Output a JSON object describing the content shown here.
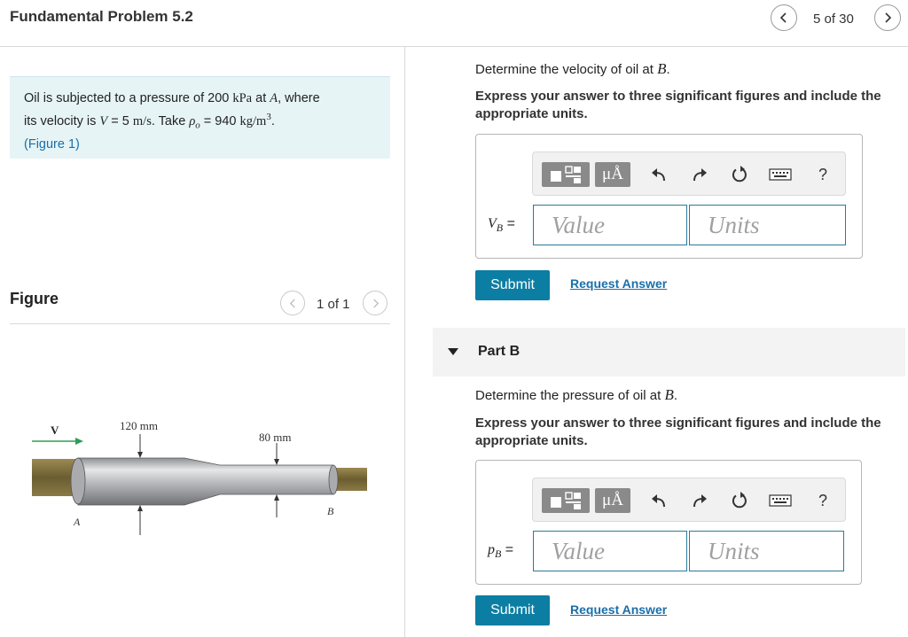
{
  "header": {
    "title": "Fundamental Problem 5.2",
    "nav_count": "5 of 30"
  },
  "problem": {
    "t1": "Oil is subjected to a pressure of 200 ",
    "u1": "kPa",
    "t2": " at ",
    "v1": "A",
    "t3": ", where",
    "t4": "its velocity is ",
    "v2": "V",
    "t5": " = 5 ",
    "u2": "m/s",
    "t6": ". Take ",
    "v3": "ρ",
    "sub3": "o",
    "t7": " = 940 ",
    "u3": "kg/m",
    "sup3": "3",
    "t8": ".",
    "link_open": "(",
    "link": "Figure 1",
    "link_close": ")"
  },
  "figure": {
    "label": "Figure",
    "count": "1 of 1",
    "dim1": "120 mm",
    "dim2": "80 mm",
    "v_label": "V",
    "a_label": "A",
    "b_label": "B"
  },
  "part_a": {
    "question_prefix": "Determine the velocity of oil at ",
    "question_var": "B",
    "question_suffix": ".",
    "instruction": "Express your answer to three significant figures and include the appropriate units.",
    "var_main": "V",
    "var_sub": "B",
    "var_eq": " =",
    "value_placeholder": "Value",
    "units_placeholder": "Units",
    "mu_label": "μÅ",
    "help_label": "?",
    "submit": "Submit",
    "request": "Request Answer"
  },
  "part_b": {
    "header": "Part B",
    "question_prefix": "Determine the pressure of oil at ",
    "question_var": "B",
    "question_suffix": ".",
    "instruction": "Express your answer to three significant figures and include the appropriate units.",
    "var_main": "p",
    "var_sub": "B",
    "var_eq": " =",
    "value_placeholder": "Value",
    "units_placeholder": "Units",
    "mu_label": "μÅ",
    "help_label": "?",
    "submit": "Submit",
    "request": "Request Answer"
  },
  "colors": {
    "accent": "#0c7ea3",
    "link": "#1a6fa8",
    "problem_bg": "#e6f4f6",
    "arrow_green": "#2e9d57"
  }
}
